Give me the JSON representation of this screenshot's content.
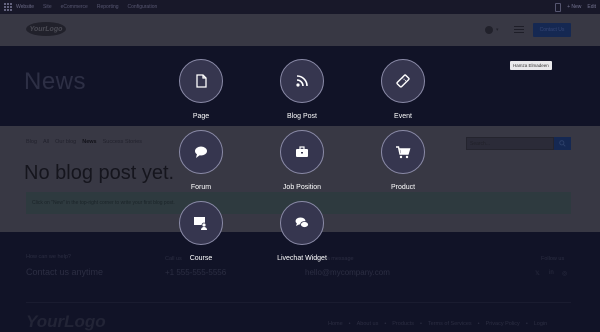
{
  "adminbar": {
    "brand": "Website",
    "menu": [
      "Site",
      "eCommerce",
      "Reporting",
      "Configuration"
    ],
    "new_label": "+ New",
    "edit_label": "Edit"
  },
  "header": {
    "logo_text": "YourLogo",
    "contact_label": "Contact Us"
  },
  "hero": {
    "title": "News"
  },
  "filters": [
    "Blog",
    "All",
    "Our blog",
    "News",
    "Success Stories"
  ],
  "filters_active_index": 3,
  "search": {
    "placeholder": "Search..."
  },
  "content": {
    "empty_title": "No blog post yet.",
    "alert_text": "Click on \"New\" in the top-right corner to write your first blog post."
  },
  "footer": {
    "help_label": "How can we help?",
    "help_big": "Contact us anytime",
    "call_label": "Call us",
    "phone": "+1 555-555-5556",
    "message_label": "Send us a message",
    "email": "hello@mycompany.com",
    "follow_label": "Follow us",
    "social": [
      "𝕏",
      "in",
      "◎"
    ],
    "logo_text": "YourLogo",
    "links": [
      "Home",
      "About us",
      "Products",
      "Terms of Services",
      "Privacy Policy",
      "Login"
    ]
  },
  "tooltip": "Hamza Elmadeen",
  "snippets": [
    {
      "label": "Page",
      "icon": "file-icon"
    },
    {
      "label": "Blog Post",
      "icon": "rss-icon"
    },
    {
      "label": "Event",
      "icon": "ticket-icon"
    },
    {
      "label": "Forum",
      "icon": "comment-icon"
    },
    {
      "label": "Job Position",
      "icon": "briefcase-icon"
    },
    {
      "label": "Product",
      "icon": "cart-icon"
    },
    {
      "label": "Course",
      "icon": "course-icon"
    },
    {
      "label": "Livechat Widget",
      "icon": "chat-icon"
    }
  ]
}
